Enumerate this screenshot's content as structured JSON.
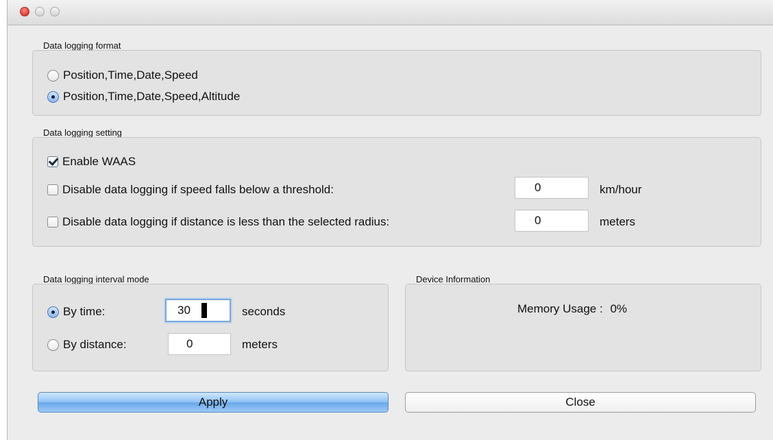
{
  "logging_format": {
    "title": "Data logging format",
    "options": [
      {
        "label": "Position,Time,Date,Speed",
        "selected": false
      },
      {
        "label": "Position,Time,Date,Speed,Altitude",
        "selected": true
      }
    ]
  },
  "logging_setting": {
    "title": "Data logging setting",
    "enable_waas": {
      "label": "Enable WAAS",
      "checked": true
    },
    "speed_threshold": {
      "label": "Disable data logging if speed falls below a threshold:",
      "checked": false,
      "value": "0",
      "unit": "km/hour"
    },
    "distance_radius": {
      "label": "Disable data logging if distance is less than the selected radius:",
      "checked": false,
      "value": "0",
      "unit": "meters"
    }
  },
  "interval_mode": {
    "title": "Data logging interval mode",
    "by_time": {
      "label": "By time:",
      "selected": true,
      "value": "30",
      "unit": "seconds"
    },
    "by_distance": {
      "label": "By distance:",
      "selected": false,
      "value": "0",
      "unit": "meters"
    }
  },
  "device_info": {
    "title": "Device Information",
    "memory_label": "Memory Usage :",
    "memory_value": "0%"
  },
  "buttons": {
    "apply": "Apply",
    "close": "Close"
  },
  "colors": {
    "window_bg": "#ececec",
    "group_bg": "#e3e3e3",
    "apply_blue": "#8fc1f3",
    "close_red": "#e0443a"
  }
}
